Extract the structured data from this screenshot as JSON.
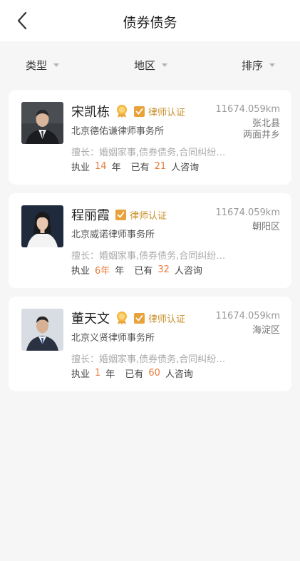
{
  "header": {
    "title": "债券债务"
  },
  "filters": [
    {
      "label": "类型"
    },
    {
      "label": "地区"
    },
    {
      "label": "排序"
    }
  ],
  "colors": {
    "accent": "#e87b3a",
    "cert": "#e9a23b",
    "background": "#f6f6f6"
  },
  "lawyers": [
    {
      "name": "宋凯栋",
      "medal": true,
      "cert_label": "律师认证",
      "distance": "11674.059km",
      "region_lines": [
        "张北县",
        "两面井乡"
      ],
      "firm": "北京德佑谦律师事务所",
      "skill": "擅长：婚姻家事,债券债务,合同纠纷…",
      "practice_prefix": "执业",
      "years": "14",
      "years_unit": "年",
      "consult_prefix": "已有",
      "consults": "21",
      "consult_suffix": "人咨询"
    },
    {
      "name": "程丽霞",
      "medal": false,
      "cert_label": "律师认证",
      "distance": "11674.059km",
      "region_lines": [
        "朝阳区"
      ],
      "firm": "北京威诺律师事务所",
      "skill": "擅长：婚姻家事,债券债务,合同纠纷…",
      "practice_prefix": "执业",
      "years": "6年",
      "years_unit": "年",
      "consult_prefix": "已有",
      "consults": "32",
      "consult_suffix": "人咨询"
    },
    {
      "name": "董天文",
      "medal": true,
      "cert_label": "律师认证",
      "distance": "11674.059km",
      "region_lines": [
        "海淀区"
      ],
      "firm": "北京义贤律师事务所",
      "skill": "擅长：婚姻家事,债券债务,合同纠纷…",
      "practice_prefix": "执业",
      "years": "1",
      "years_unit": "年",
      "consult_prefix": "已有",
      "consults": "60",
      "consult_suffix": "人咨询"
    }
  ]
}
